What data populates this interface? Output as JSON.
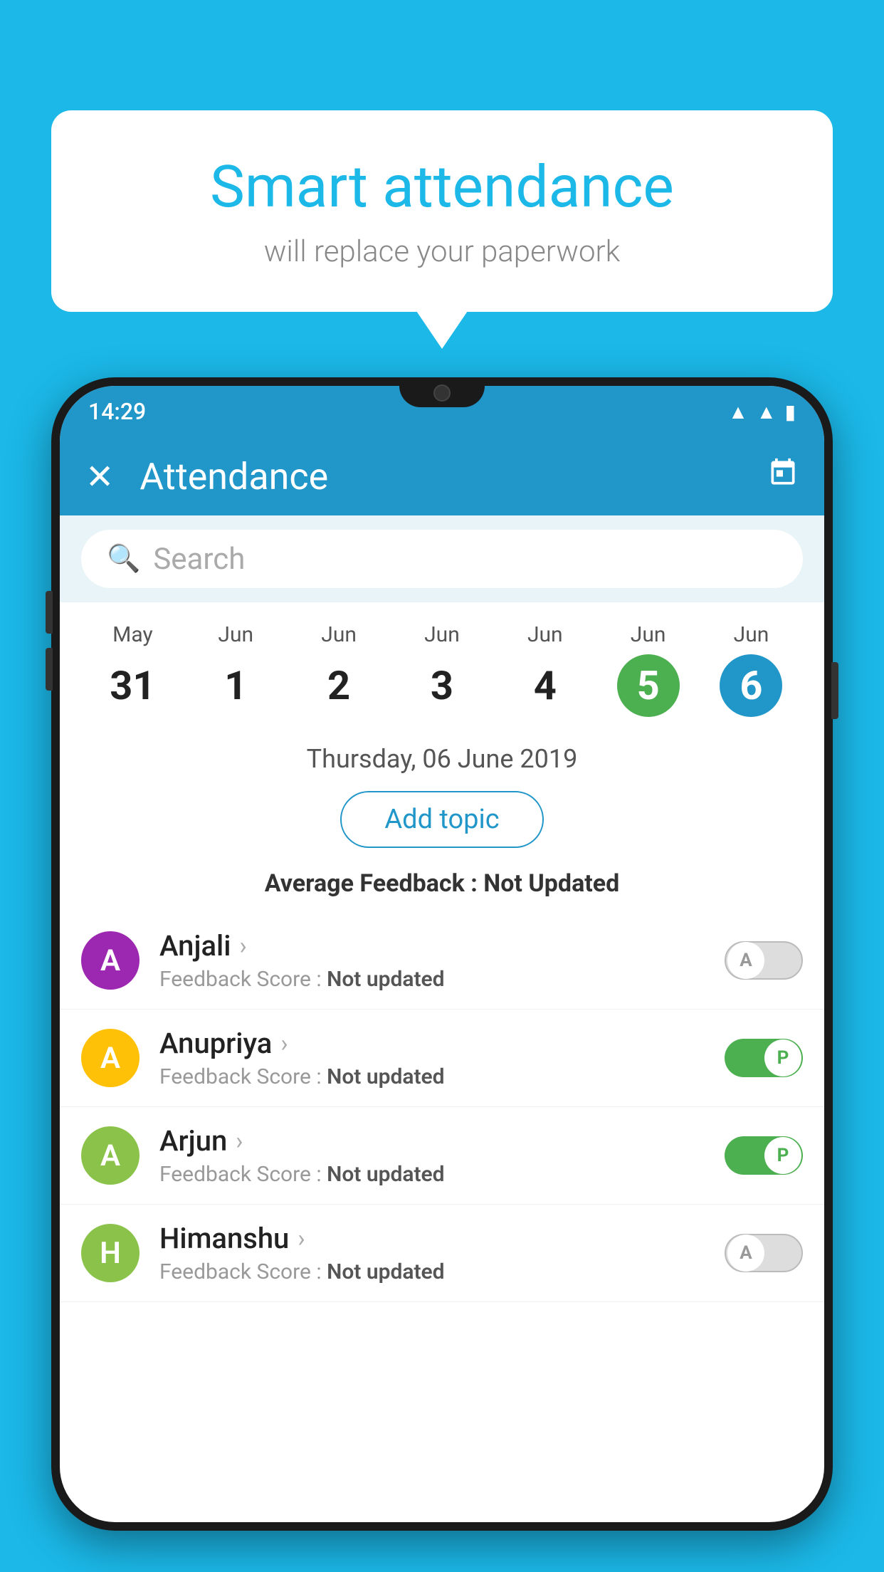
{
  "background_color": "#1BB8E8",
  "bubble": {
    "title": "Smart attendance",
    "subtitle": "will replace your paperwork"
  },
  "status_bar": {
    "time": "14:29",
    "wifi_icon": "▲",
    "signal_icon": "▲",
    "battery_icon": "▮"
  },
  "app_bar": {
    "title": "Attendance",
    "close_icon": "✕",
    "calendar_icon": "📅"
  },
  "search": {
    "placeholder": "Search"
  },
  "calendar": {
    "days": [
      {
        "month": "May",
        "date": "31",
        "state": "normal"
      },
      {
        "month": "Jun",
        "date": "1",
        "state": "normal"
      },
      {
        "month": "Jun",
        "date": "2",
        "state": "normal"
      },
      {
        "month": "Jun",
        "date": "3",
        "state": "normal"
      },
      {
        "month": "Jun",
        "date": "4",
        "state": "normal"
      },
      {
        "month": "Jun",
        "date": "5",
        "state": "today"
      },
      {
        "month": "Jun",
        "date": "6",
        "state": "selected"
      }
    ]
  },
  "selected_date": "Thursday, 06 June 2019",
  "add_topic_label": "Add topic",
  "avg_feedback_label": "Average Feedback :",
  "avg_feedback_value": "Not Updated",
  "students": [
    {
      "name": "Anjali",
      "feedback_label": "Feedback Score :",
      "feedback_value": "Not updated",
      "avatar_bg": "#9C27B0",
      "avatar_letter": "A",
      "toggle_state": "off",
      "toggle_letter": "A"
    },
    {
      "name": "Anupriya",
      "feedback_label": "Feedback Score :",
      "feedback_value": "Not updated",
      "avatar_bg": "#FFC107",
      "avatar_letter": "A",
      "toggle_state": "on",
      "toggle_letter": "P"
    },
    {
      "name": "Arjun",
      "feedback_label": "Feedback Score :",
      "feedback_value": "Not updated",
      "avatar_bg": "#8BC34A",
      "avatar_letter": "A",
      "toggle_state": "on",
      "toggle_letter": "P"
    },
    {
      "name": "Himanshu",
      "feedback_label": "Feedback Score :",
      "feedback_value": "Not updated",
      "avatar_bg": "#8BC34A",
      "avatar_letter": "H",
      "toggle_state": "off",
      "toggle_letter": "A"
    }
  ]
}
